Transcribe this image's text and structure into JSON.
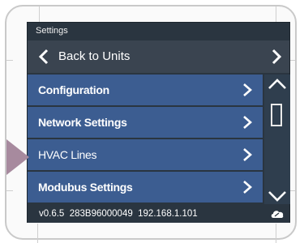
{
  "screen": {
    "title": "Settings",
    "back_label": "Back to Units",
    "menu_items": [
      {
        "label": "Configuration",
        "bold": true
      },
      {
        "label": "Network Settings",
        "bold": true
      },
      {
        "label": "HVAC Lines",
        "bold": false
      },
      {
        "label": "Modubus Settings",
        "bold": true
      }
    ],
    "status": {
      "version": "v0.6.5",
      "serial": "283B96000049",
      "ip": "192.168.1.101",
      "logo_icon": "cloud-logo-icon"
    }
  },
  "colors": {
    "screen_bg": "#2a3540",
    "menu_item": "#3c5d91",
    "back_row": "#3a4450",
    "pointer": "#a78a9e"
  }
}
